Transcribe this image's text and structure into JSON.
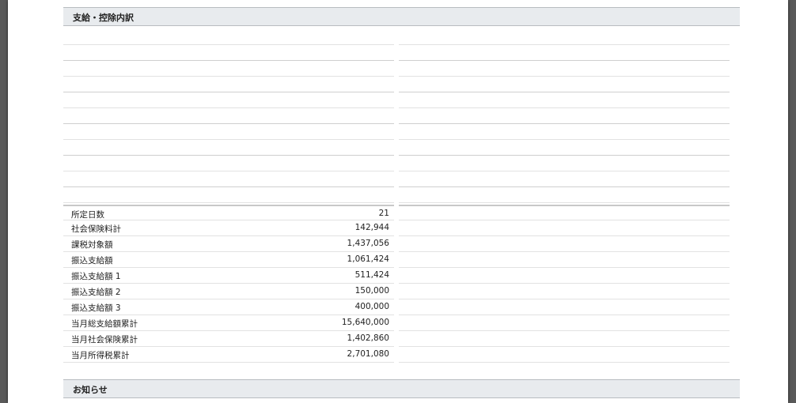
{
  "sections": {
    "breakdown_title": "支給・控除内訳",
    "notice_title": "お知らせ"
  },
  "summary_rows": [
    {
      "label": "所定日数",
      "value": "21"
    },
    {
      "label": "社会保険料計",
      "value": "142,944"
    },
    {
      "label": "課税対象額",
      "value": "1,437,056"
    },
    {
      "label": "振込支給額",
      "value": "1,061,424"
    },
    {
      "label": "振込支給額 1",
      "value": "511,424"
    },
    {
      "label": "振込支給額 2",
      "value": "150,000"
    },
    {
      "label": "振込支給額 3",
      "value": "400,000"
    },
    {
      "label": "当月総支給額累計",
      "value": "15,640,000"
    },
    {
      "label": "当月社会保険累計",
      "value": "1,402,860"
    },
    {
      "label": "当月所得税累計",
      "value": "2,701,080"
    }
  ]
}
